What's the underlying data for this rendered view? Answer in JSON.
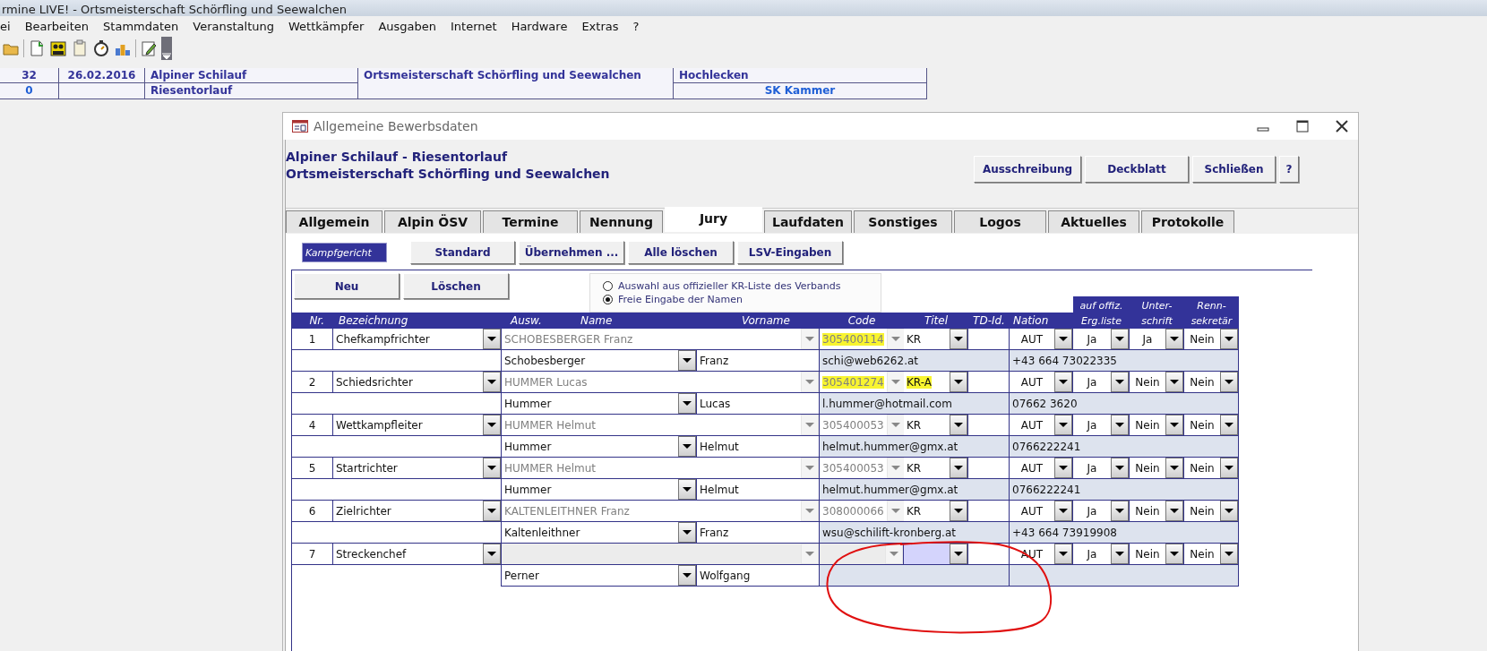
{
  "app_title": "rmine LIVE! - Ortsmeisterschaft Schörfling und Seewalchen",
  "menu": [
    "ei",
    "Bearbeiten",
    "Stammdaten",
    "Veranstaltung",
    "Wettkämpfer",
    "Ausgaben",
    "Internet",
    "Hardware",
    "Extras",
    "?"
  ],
  "event_info": {
    "row_1": {
      "nr": "32",
      "datum": "26.02.2016",
      "sportart": "Alpiner Schilauf",
      "ort": "Hochlecken"
    },
    "row_2": {
      "nr": "0",
      "disziplin": "Riesentorlauf",
      "verein": "SK Kammer"
    },
    "veranstaltung": "Ortsmeisterschaft Schörfling und Seewalchen"
  },
  "dialog": {
    "title": "Allgemeine Bewerbsdaten",
    "heading": [
      "Alpiner Schilauf - Riesentorlauf",
      "Ortsmeisterschaft Schörfling und Seewalchen"
    ],
    "buttons": [
      "Ausschreibung",
      "Deckblatt",
      "Schließen"
    ],
    "help": "?",
    "tabs": [
      {
        "label": "Allgemein",
        "selected": false
      },
      {
        "label": "Alpin ÖSV",
        "selected": false
      },
      {
        "label": "Termine",
        "selected": false
      },
      {
        "label": "Nennung",
        "selected": false
      },
      {
        "label": "Jury",
        "selected": true
      },
      {
        "label": "Laufdaten",
        "selected": false
      },
      {
        "label": "Sonstiges",
        "selected": false
      },
      {
        "label": "Logos",
        "selected": false
      },
      {
        "label": "Aktuelles",
        "selected": false
      },
      {
        "label": "Protokolle",
        "selected": false
      }
    ],
    "section_label": "Kampfgericht",
    "section_buttons": [
      "Standard",
      "Übernehmen ...",
      "Alle löschen",
      "LSV-Eingaben"
    ],
    "row_buttons": [
      "Neu",
      "Löschen"
    ],
    "input_mode": [
      {
        "label": "Auswahl aus offizieller KR-Liste des Verbands",
        "selected": false
      },
      {
        "label": "Freie Eingabe der Namen",
        "selected": true
      }
    ],
    "columns": {
      "nr": "Nr.",
      "bezeichnung": "Bezeichnung",
      "auswahl": "Ausw.",
      "name": "Name",
      "vorname": "Vorname",
      "code": "Code",
      "titel": "Titel",
      "td_id": "TD-Id.",
      "nation": "Nation",
      "ergebnisliste": [
        "auf offiz.",
        "Erg.liste"
      ],
      "unterschrift": [
        "Unter-",
        "schrift"
      ],
      "rennsekretaer": [
        "Renn-",
        "sekretär"
      ]
    },
    "rows": [
      {
        "nr": "1",
        "bezeichnung": "Chefkampfrichter",
        "auswahl": "SCHOBESBERGER Franz",
        "code": "305400114",
        "code_marked": true,
        "titel": "KR",
        "titel_marked": false,
        "titel_focused": false,
        "nation": "AUT",
        "ergebnisliste": "Ja",
        "unterschrift": "Ja",
        "rennsekretaer": "Nein",
        "name": "Schobesberger",
        "vorname": "Franz",
        "email": "schi@web6262.at",
        "telefon": "+43 664 73022335"
      },
      {
        "nr": "2",
        "bezeichnung": "Schiedsrichter",
        "auswahl": "HUMMER Lucas",
        "code": "305401274",
        "code_marked": true,
        "titel": "KR-A",
        "titel_marked": true,
        "titel_focused": false,
        "nation": "AUT",
        "ergebnisliste": "Ja",
        "unterschrift": "Nein",
        "rennsekretaer": "Nein",
        "name": "Hummer",
        "vorname": "Lucas",
        "email": "l.hummer@hotmail.com",
        "telefon": "07662 3620"
      },
      {
        "nr": "4",
        "bezeichnung": "Wettkampfleiter",
        "auswahl": "HUMMER Helmut",
        "code": "305400053",
        "code_marked": false,
        "titel": "KR",
        "titel_marked": false,
        "titel_focused": false,
        "nation": "AUT",
        "ergebnisliste": "Ja",
        "unterschrift": "Nein",
        "rennsekretaer": "Nein",
        "name": "Hummer",
        "vorname": "Helmut",
        "email": "helmut.hummer@gmx.at",
        "telefon": "0766222241"
      },
      {
        "nr": "5",
        "bezeichnung": "Startrichter",
        "auswahl": "HUMMER Helmut",
        "code": "305400053",
        "code_marked": false,
        "titel": "KR",
        "titel_marked": false,
        "titel_focused": false,
        "nation": "AUT",
        "ergebnisliste": "Ja",
        "unterschrift": "Nein",
        "rennsekretaer": "Nein",
        "name": "Hummer",
        "vorname": "Helmut",
        "email": "helmut.hummer@gmx.at",
        "telefon": "0766222241"
      },
      {
        "nr": "6",
        "bezeichnung": "Zielrichter",
        "auswahl": "KALTENLEITHNER Franz",
        "code": "308000066",
        "code_marked": false,
        "titel": "KR",
        "titel_marked": false,
        "titel_focused": false,
        "nation": "AUT",
        "ergebnisliste": "Ja",
        "unterschrift": "Nein",
        "rennsekretaer": "Nein",
        "name": "Kaltenleithner",
        "vorname": "Franz",
        "email": "wsu@schilift-kronberg.at",
        "telefon": "+43 664 73919908"
      },
      {
        "nr": "7",
        "bezeichnung": "Streckenchef",
        "titel_focused": true,
        "nation": "AUT",
        "ergebnisliste": "Ja",
        "unterschrift": "Nein",
        "rennsekretaer": "Nein",
        "name": "Perner",
        "vorname": "Wolfgang"
      }
    ]
  }
}
